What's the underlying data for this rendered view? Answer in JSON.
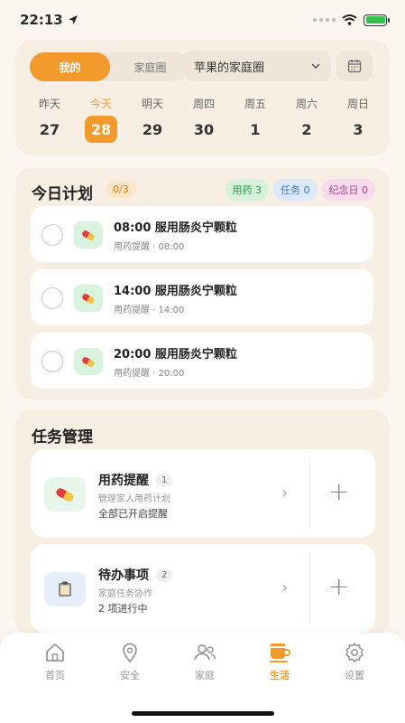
{
  "status_bar": {
    "time": "22:13"
  },
  "header": {
    "segments": [
      {
        "label": "我的",
        "active": true
      },
      {
        "label": "家庭圈",
        "active": false
      }
    ],
    "family_select": "苹果的家庭圈"
  },
  "week": [
    {
      "wd": "昨天",
      "date": "27"
    },
    {
      "wd": "今天",
      "date": "28",
      "today": true
    },
    {
      "wd": "明天",
      "date": "29"
    },
    {
      "wd": "周四",
      "date": "30"
    },
    {
      "wd": "周五",
      "date": "1"
    },
    {
      "wd": "周六",
      "date": "2"
    },
    {
      "wd": "周日",
      "date": "3"
    }
  ],
  "plan": {
    "title": "今日计划",
    "count": "0/3",
    "chips": [
      {
        "label": "用药 3",
        "color": "#2d9a45"
      },
      {
        "label": "任务 0",
        "color": "#3a78c7"
      },
      {
        "label": "纪念日 0",
        "color": "#b3418a"
      }
    ],
    "items": [
      {
        "title": "08:00 服用肠炎宁颗粒",
        "sub": "用药提醒 · 08:00"
      },
      {
        "title": "14:00 服用肠炎宁颗粒",
        "sub": "用药提醒 · 14:00"
      },
      {
        "title": "20:00 服用肠炎宁颗粒",
        "sub": "用药提醒 · 20:00"
      }
    ]
  },
  "tasks": {
    "title": "任务管理",
    "items": [
      {
        "title": "用药提醒",
        "num": "1",
        "desc": "管理家人用药计划",
        "status": "全部已开启提醒",
        "icon": "pill-icon"
      },
      {
        "title": "待办事项",
        "num": "2",
        "desc": "家庭任务协作",
        "status": "2 项进行中",
        "icon": "clipboard-icon"
      }
    ]
  },
  "tabbar": [
    {
      "label": "首页",
      "icon": "home-icon"
    },
    {
      "label": "安全",
      "icon": "location-icon"
    },
    {
      "label": "家庭",
      "icon": "family-icon"
    },
    {
      "label": "生活",
      "icon": "coffee-cup-icon",
      "active": true
    },
    {
      "label": "设置",
      "icon": "gear-icon"
    }
  ],
  "colors": {
    "accent": "#f29a2c",
    "card_bg": "#f7efe3",
    "page_bg": "#fbf6ef"
  }
}
